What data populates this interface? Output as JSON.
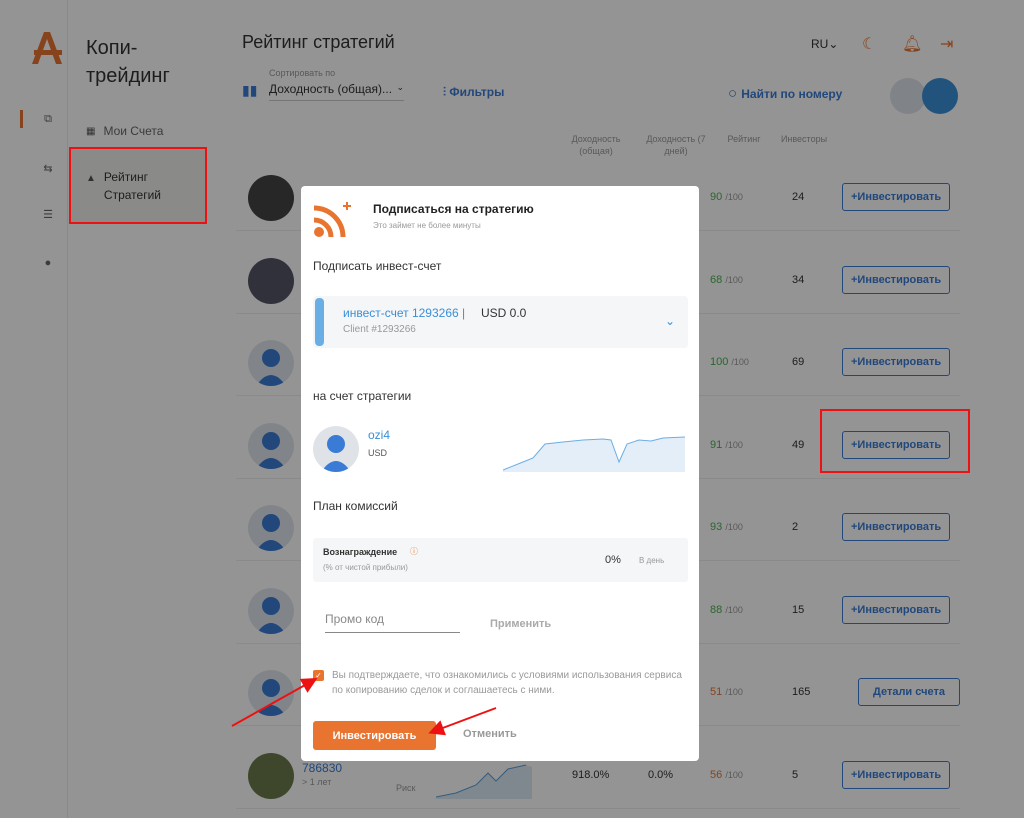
{
  "app": {
    "brand_line1": "Копи-",
    "brand_line2": "трейдинг",
    "nav": [
      {
        "label": "Мои Счета"
      },
      {
        "label_line1": "Рейтинг",
        "label_line2": "Стратегий"
      }
    ]
  },
  "header": {
    "title": "Рейтинг стратегий",
    "sort_label": "Сортировать по",
    "sort_value": "Доходность (общая)...",
    "filters": "Фильтры",
    "find_by_number": "Найти по номеру",
    "language": "RU"
  },
  "columns": {
    "yield_total_line1": "Доходность",
    "yield_total_line2": "(общая)",
    "yield_7d_line1": "Доходность (7",
    "yield_7d_line2": "дней)",
    "rating": "Рейтинг",
    "investors": "Инвесторы"
  },
  "rows": [
    {
      "rating": "90",
      "rating_max": "/100",
      "investors": "24",
      "button": "+Инвестировать",
      "rating_color": "#4caf50"
    },
    {
      "rating": "68",
      "rating_max": "/100",
      "investors": "34",
      "button": "+Инвестировать",
      "rating_color": "#4caf50"
    },
    {
      "rating": "100",
      "rating_max": "/100",
      "investors": "69",
      "button": "+Инвестировать",
      "rating_color": "#4caf50"
    },
    {
      "rating": "91",
      "rating_max": "/100",
      "investors": "49",
      "button": "+Инвестировать",
      "rating_color": "#4caf50"
    },
    {
      "rating": "93",
      "rating_max": "/100",
      "investors": "2",
      "button": "+Инвестировать",
      "rating_color": "#4caf50"
    },
    {
      "rating": "88",
      "rating_max": "/100",
      "investors": "15",
      "button": "+Инвестировать",
      "rating_color": "#4caf50"
    },
    {
      "rating": "51",
      "rating_max": "/100",
      "investors": "165",
      "button": "Детали счета",
      "rating_color": "#e8742f"
    },
    {
      "name": "786830",
      "age": "> 1 лет",
      "risk": "Риск",
      "yield_total": "918.0%",
      "yield_7d": "0.0%",
      "rating": "56",
      "rating_max": "/100",
      "investors": "5",
      "button": "+Инвестировать",
      "rating_color": "#e8742f"
    }
  ],
  "modal": {
    "title": "Подписаться на стратегию",
    "subtitle": "Это займет не более минуты",
    "section_account": "Подписать инвест-счет",
    "account_name": "инвест-счет 1293266 |",
    "account_currency": "USD 0.0",
    "account_client": "Client #1293266",
    "section_strategy": "на счет стратегии",
    "strategy_name": "ozi4",
    "strategy_currency": "USD",
    "section_fees": "План комиссий",
    "fee_title": "Вознаграждение",
    "fee_subtitle": "(% от чистой прибыли)",
    "fee_value": "0%",
    "fee_period": "В день",
    "promo_placeholder": "Промо код",
    "apply": "Применить",
    "agreement": "Вы подтверждаете, что ознакомились с условиями использования сервиса по копированию сделок и соглашаетесь с ними.",
    "invest_button": "Инвестировать",
    "cancel_button": "Отменить"
  },
  "colors": {
    "accent": "#e8742f",
    "link": "#3a7bd5",
    "annotation": "#ee1111"
  }
}
